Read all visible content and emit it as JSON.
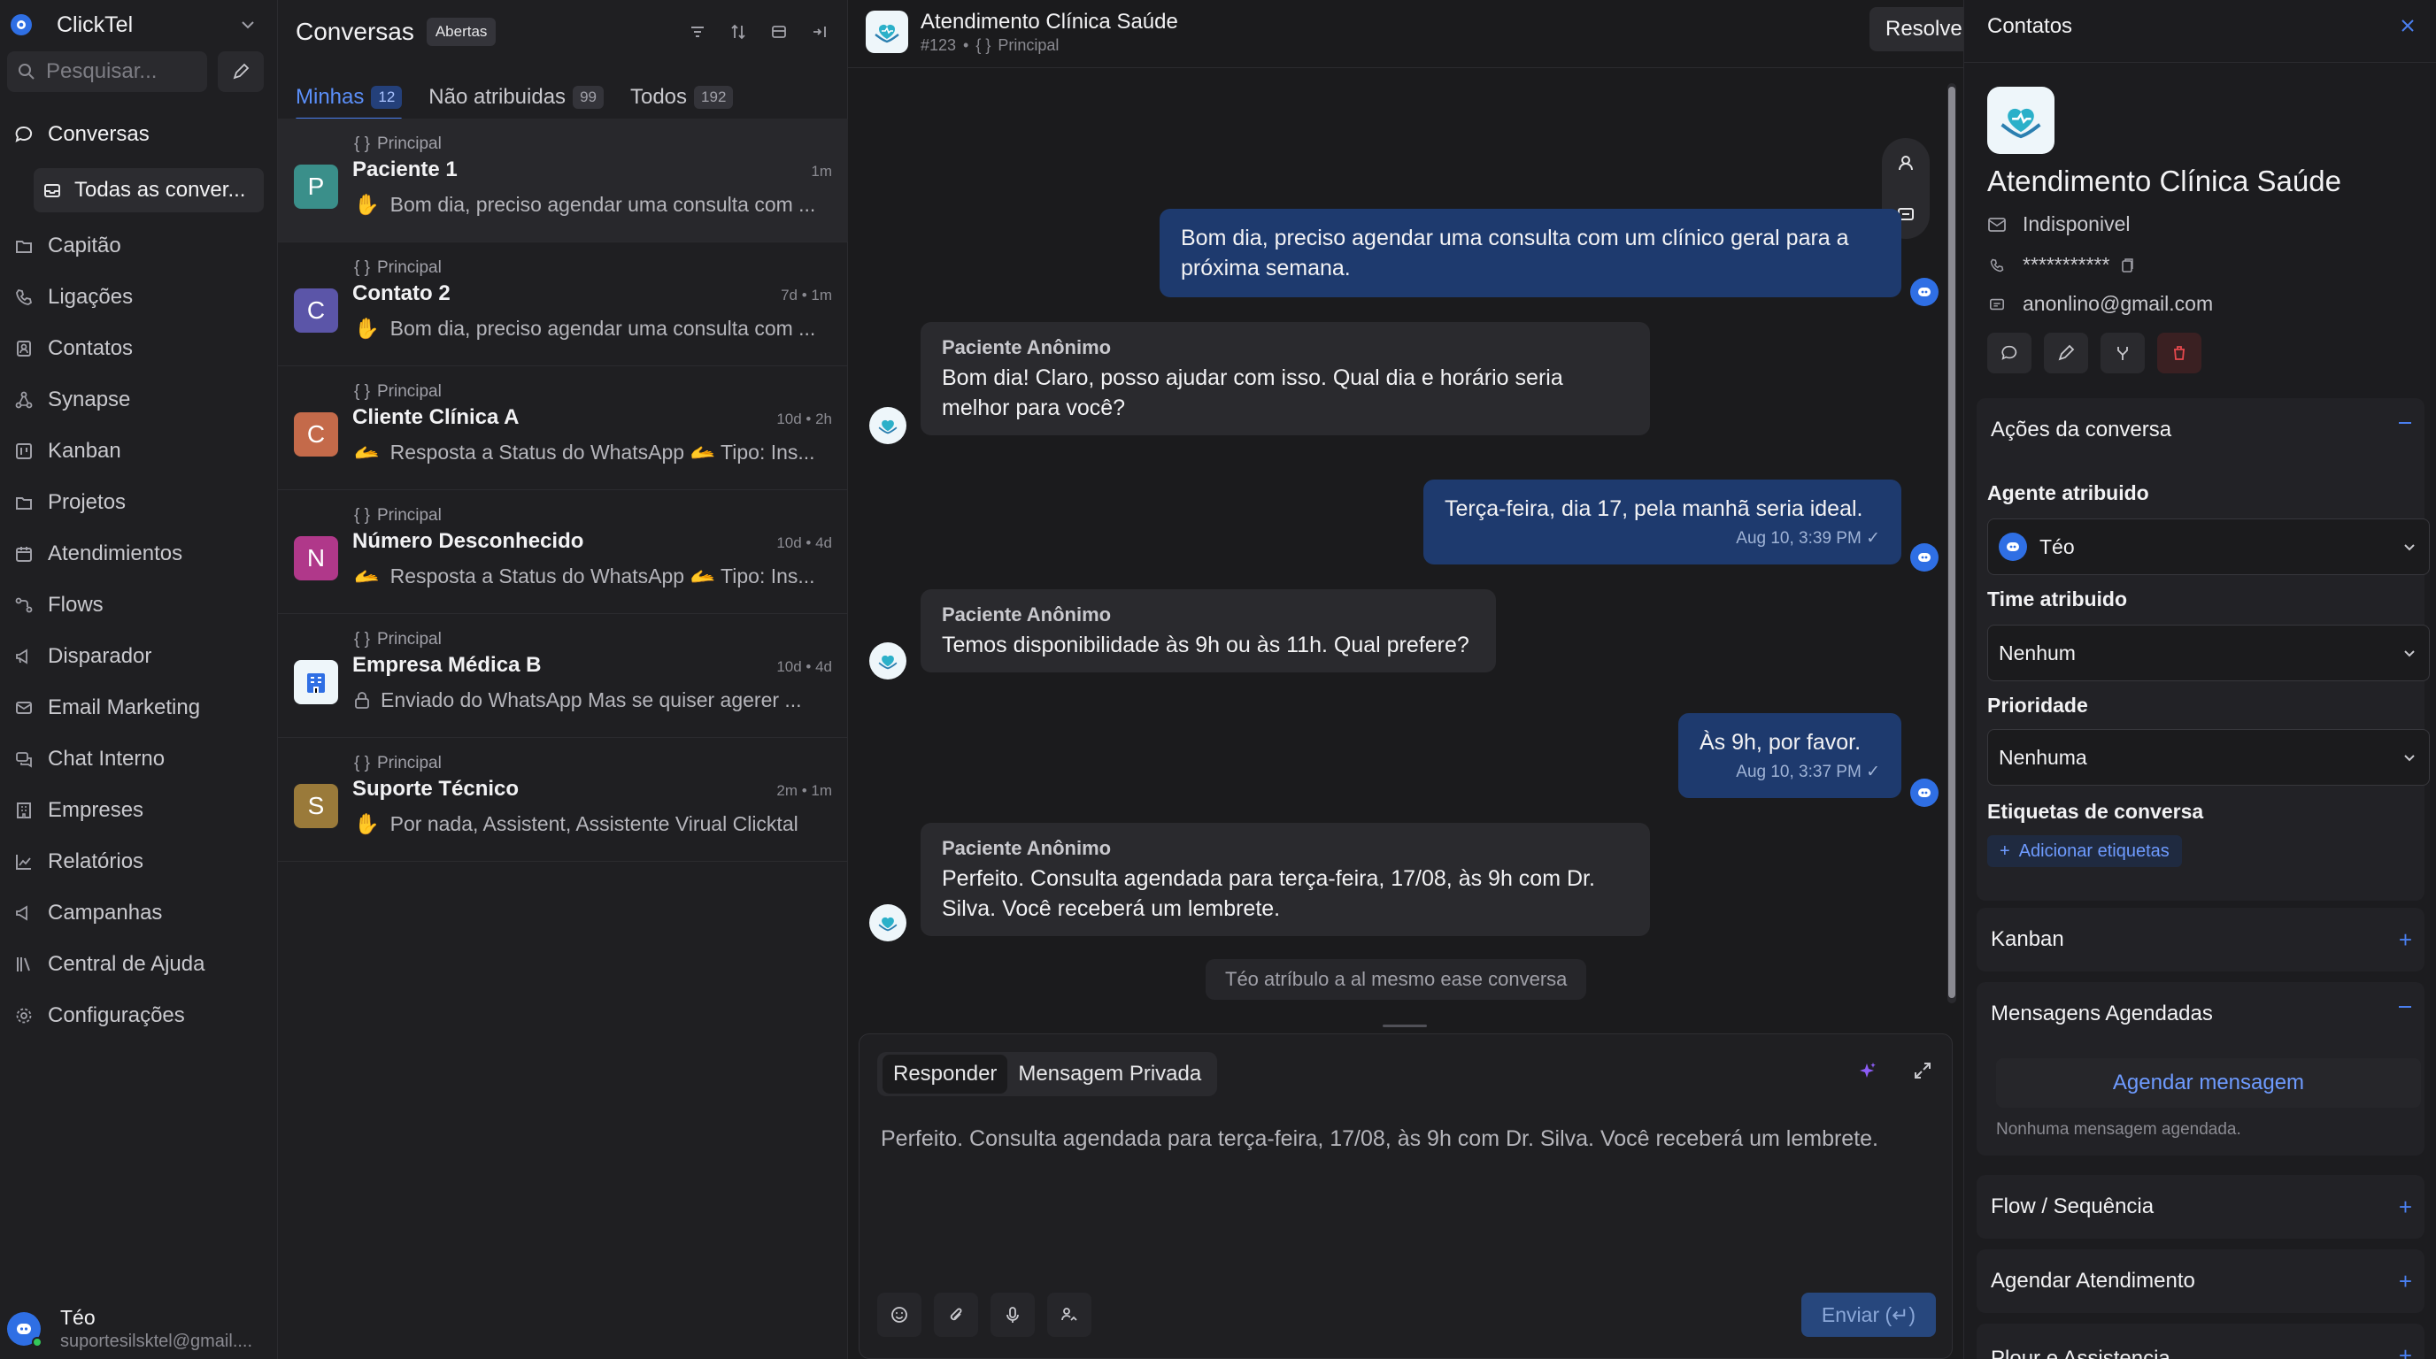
{
  "sidebar": {
    "brand": "ClickTel",
    "search_placeholder": "Pesquisar...",
    "nav": [
      {
        "label": "Conversas",
        "icon": "chat-bubble-icon"
      },
      {
        "label": "Capitão",
        "icon": "folder-icon"
      },
      {
        "label": "Ligações",
        "icon": "phone-icon"
      },
      {
        "label": "Contatos",
        "icon": "contacts-icon"
      },
      {
        "label": "Synapse",
        "icon": "network-icon"
      },
      {
        "label": "Kanban",
        "icon": "kanban-icon"
      },
      {
        "label": "Projetos",
        "icon": "folder-icon"
      },
      {
        "label": "Atendimientos",
        "icon": "calendar-icon"
      },
      {
        "label": "Flows",
        "icon": "flow-icon"
      },
      {
        "label": "Disparador",
        "icon": "megaphone-icon"
      },
      {
        "label": "Email Marketing",
        "icon": "mail-icon"
      },
      {
        "label": "Chat Interno",
        "icon": "chat-internal-icon"
      },
      {
        "label": "Empreses",
        "icon": "building-icon"
      },
      {
        "label": "Relatórios",
        "icon": "chart-icon"
      },
      {
        "label": "Campanhas",
        "icon": "megaphone-icon"
      },
      {
        "label": "Central de Ajuda",
        "icon": "library-icon"
      },
      {
        "label": "Configurações",
        "icon": "gear-icon"
      }
    ],
    "sub_item": "Todas as conver...",
    "user": {
      "name": "Téo",
      "email": "suportesilsktel@gmail...."
    }
  },
  "conversations": {
    "title": "Conversas",
    "filter_badge": "Abertas",
    "tabs": [
      {
        "label": "Minhas",
        "count": "12"
      },
      {
        "label": "Não atribuidas",
        "count": "99"
      },
      {
        "label": "Todos",
        "count": "192"
      }
    ],
    "items": [
      {
        "inbox": "Principal",
        "name": "Paciente 1",
        "time": "1m",
        "preview": "Bom dia, preciso agendar uma consulta com ...",
        "avatar": "P",
        "color": "#3a8f8a"
      },
      {
        "inbox": "Principal",
        "name": "Contato 2",
        "time": "7d • 1m",
        "preview": "Bom dia, preciso agendar uma consulta com ...",
        "avatar": "C",
        "color": "#5b55a8"
      },
      {
        "inbox": "Principal",
        "name": "Cliente Clínica A",
        "time": "10d • 2h",
        "preview": "Resposta a Status do WhatsApp 🫴 Tipo: Ins...",
        "avatar": "C",
        "color": "#c46a4a"
      },
      {
        "inbox": "Principal",
        "name": "Número Desconhecido",
        "time": "10d • 4d",
        "preview": "Resposta a Status do WhatsApp 🫴 Tipo: Ins...",
        "avatar": "N",
        "color": "#b0388a"
      },
      {
        "inbox": "Principal",
        "name": "Empresa Médica B",
        "time": "10d • 4d",
        "preview": "Enviado do WhatsApp Mas se quiser agerer ...",
        "avatar": "",
        "color": "#eef6fa"
      },
      {
        "inbox": "Principal",
        "name": "Suporte Técnico",
        "time": "2m • 1m",
        "preview": "Por nada, Assistent, Assistente Virual Clicktal",
        "avatar": "S",
        "color": "#9a7a3a"
      }
    ]
  },
  "chat": {
    "title": "Atendimento Clínica Saúde",
    "id": "#123",
    "inbox": "Principal",
    "resolve_label": "Resolver",
    "messages": {
      "m1": {
        "text": "Bom dia, preciso agendar uma consulta com um clínico geral para a próxima semana."
      },
      "m2": {
        "sender": "Paciente Anônimo",
        "text": "Bom dia! Claro, posso ajudar com isso. Qual dia e horário seria melhor para você?"
      },
      "m3": {
        "text": "Terça-feira, dia 17, pela manhã seria ideal.",
        "meta": "Aug 10, 3:39 PM ✓"
      },
      "m4": {
        "sender": "Paciente Anônimo",
        "text": "Temos disponibilidade às 9h ou às 11h. Qual prefere?"
      },
      "m5": {
        "text": "Às 9h, por favor.",
        "meta": "Aug 10, 3:37 PM ✓"
      },
      "m6": {
        "sender": "Paciente Anônimo",
        "text": "Perfeito. Consulta agendada para terça-feira, 17/08, às 9h com Dr. Silva. Você receberá um lembrete."
      }
    },
    "activity": "Téo atríbulo a al mesmo ease conversa",
    "composer": {
      "tab_reply": "Responder",
      "tab_private": "Mensagem Privada",
      "draft": "Perfeito. Consulta agendada para terça-feira, 17/08, às 9h com Dr. Silva. Você receberá um lembrete.",
      "send_label": "Enviar (↵)"
    }
  },
  "contact_panel": {
    "title": "Contatos",
    "name": "Atendimento Clínica Saúde",
    "status": "Indisponivel",
    "phone": "***********",
    "email": "anonlino@gmail.com",
    "sections": {
      "actions": "Ações da conversa",
      "kanban": "Kanban",
      "scheduled": "Mensagens Agendadas",
      "flow": "Flow / Sequência",
      "schedule_service": "Agendar Atendimento",
      "more": "Plour e Assistencia"
    },
    "fields": {
      "agent_label": "Agente atribuido",
      "agent_value": "Téo",
      "team_label": "Time atribuido",
      "team_value": "Nenhum",
      "priority_label": "Prioridade",
      "priority_value": "Nenhuma",
      "tags_label": "Etiquetas de conversa",
      "add_tags": "Adicionar etiquetas"
    },
    "schedule_button": "Agendar mensagem",
    "no_scheduled": "Nonhuma mensagem agendada."
  },
  "colors": {
    "accent": "#4a7ff0",
    "outgoing_bubble": "#1e3a6e",
    "incoming_bubble": "#2a2a2e"
  }
}
